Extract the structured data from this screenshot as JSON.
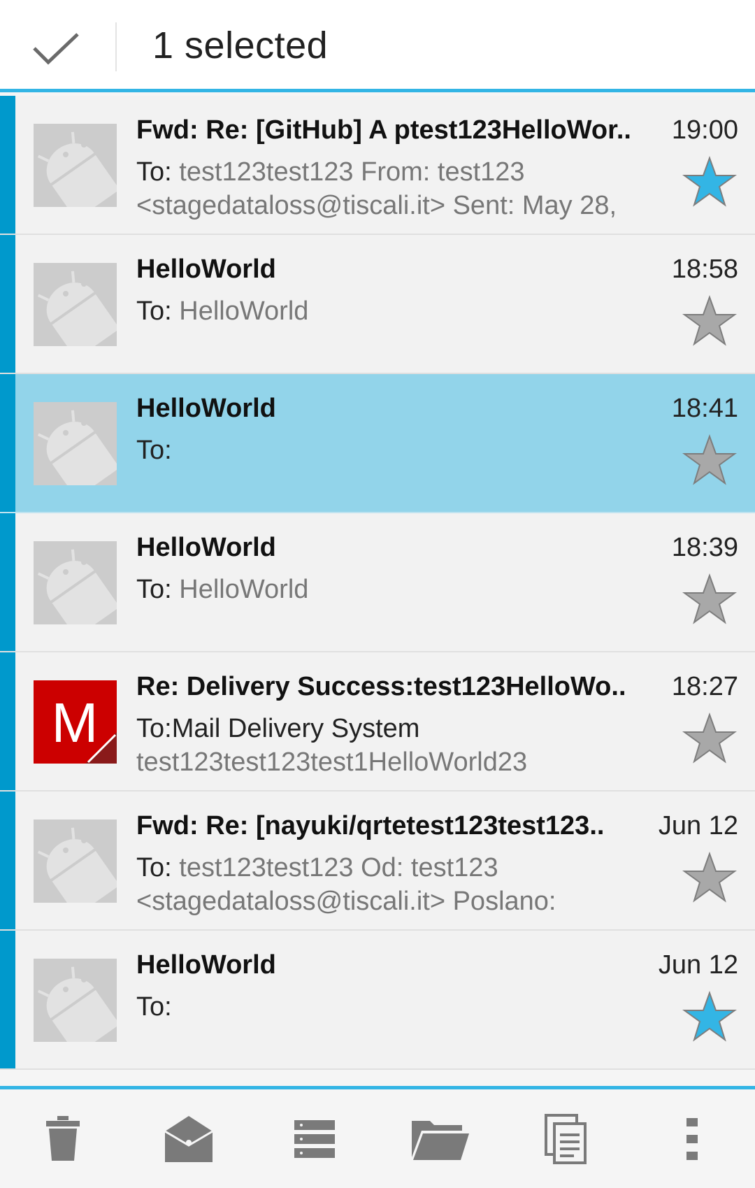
{
  "action_bar": {
    "done_icon": "checkmark-icon",
    "title": "1 selected",
    "accent_color": "#33b5e5"
  },
  "messages": [
    {
      "subject": "Fwd: Re: [GitHub] A ptest123HelloWor..",
      "time": "19:00",
      "to_label": "To:",
      "to_value": " test123test123 From: test123",
      "line3": "<stagedataloss@tiscali.it> Sent: May 28,",
      "avatar": "android-avatar-icon",
      "starred": true,
      "selected": false
    },
    {
      "subject": "HelloWorld",
      "time": "18:58",
      "to_label": "To:",
      "to_value": " HelloWorld",
      "line3": "",
      "avatar": "android-avatar-icon",
      "starred": false,
      "selected": false
    },
    {
      "subject": "HelloWorld",
      "time": "18:41",
      "to_label": "To:",
      "to_value": "",
      "line3": "",
      "avatar": "android-avatar-icon",
      "starred": false,
      "selected": true
    },
    {
      "subject": "HelloWorld",
      "time": "18:39",
      "to_label": "To:",
      "to_value": " HelloWorld",
      "line3": "",
      "avatar": "android-avatar-icon",
      "starred": false,
      "selected": false
    },
    {
      "subject": "Re: Delivery Success:test123HelloWo..",
      "time": "18:27",
      "to_label": "To:Mail Delivery System",
      "to_value": "",
      "line3": "test123test123test1HelloWorld23",
      "avatar": "letter-m-avatar-icon",
      "avatar_letter": "M",
      "starred": false,
      "selected": false
    },
    {
      "subject": "Fwd: Re: [nayuki/qrtetest123test123..",
      "time": "Jun 12",
      "to_label": "To:",
      "to_value": " test123test123 Od: test123",
      "line3": "<stagedataloss@tiscali.it> Poslano:",
      "avatar": "android-avatar-icon",
      "starred": false,
      "selected": false
    },
    {
      "subject": "HelloWorld",
      "time": "Jun 12",
      "to_label": "To:",
      "to_value": "",
      "line3": "",
      "avatar": "android-avatar-icon",
      "starred": true,
      "selected": false
    }
  ],
  "toolbar": {
    "icons": [
      "trash-icon",
      "mark-read-envelope-icon",
      "list-icon",
      "folder-icon",
      "copy-icon",
      "overflow-menu-icon"
    ]
  },
  "colors": {
    "chip": "#0099cc",
    "selected_row": "#92d4ea",
    "star_on": "#33b5e5",
    "star_off": "#a8a8a8",
    "avatar_m": "#cc0000"
  }
}
